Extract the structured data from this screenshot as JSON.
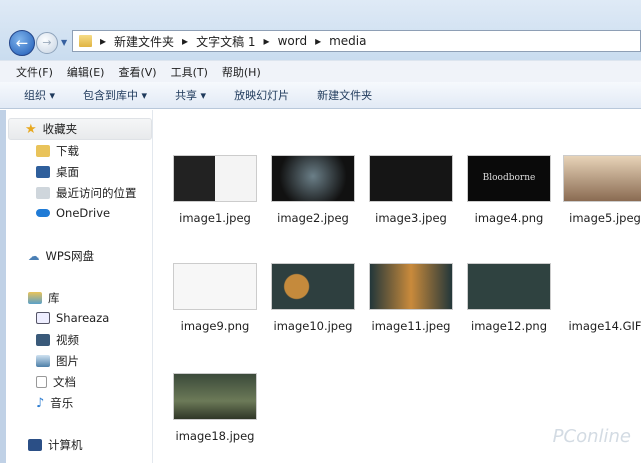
{
  "address": {
    "crumbs": [
      "新建文件夹",
      "文字文稿 1",
      "word",
      "media"
    ]
  },
  "menu": [
    "文件(F)",
    "编辑(E)",
    "查看(V)",
    "工具(T)",
    "帮助(H)"
  ],
  "toolbar": [
    "组织 ▾",
    "包含到库中 ▾",
    "共享 ▾",
    "放映幻灯片",
    "新建文件夹"
  ],
  "sidebar": {
    "favorites": "收藏夹",
    "fav_items": [
      "下载",
      "桌面",
      "最近访问的位置",
      "OneDrive"
    ],
    "wps": "WPS网盘",
    "library": "库",
    "lib_items": [
      "Shareaza",
      "视频",
      "图片",
      "文档",
      "音乐"
    ],
    "computer": "计算机"
  },
  "files": [
    {
      "name": "image1.jpeg",
      "bg": "linear-gradient(90deg,#222 0 50%,#f4f4f4 50%)"
    },
    {
      "name": "image2.jpeg",
      "bg": "radial-gradient(circle at 50% 45%,#6b7f88,#111 70%)"
    },
    {
      "name": "image3.jpeg",
      "bg": "#151515"
    },
    {
      "name": "image4.png",
      "bg": "#0a0a0a",
      "text": "Bloodborne"
    },
    {
      "name": "image5.jpeg",
      "bg": "linear-gradient(#e7d3b8,#8a6b52)"
    },
    {
      "name": "image9.png",
      "bg": "#f7f7f7"
    },
    {
      "name": "image10.jpeg",
      "bg": "radial-gradient(circle at 30% 50%,#c58a3c 0 12px,#2e3f3f 13px)"
    },
    {
      "name": "image11.jpeg",
      "bg": "linear-gradient(90deg,#23373a,#c98a3b 50%,#23373a)"
    },
    {
      "name": "image12.png",
      "bg": "#2f4240"
    },
    {
      "name": "image14.GIF",
      "bg": "none"
    },
    {
      "name": "image18.jpeg",
      "bg": "linear-gradient(#3b4a3a,#6c7a58 60%,#2f3627)"
    }
  ],
  "watermark": "PConline"
}
